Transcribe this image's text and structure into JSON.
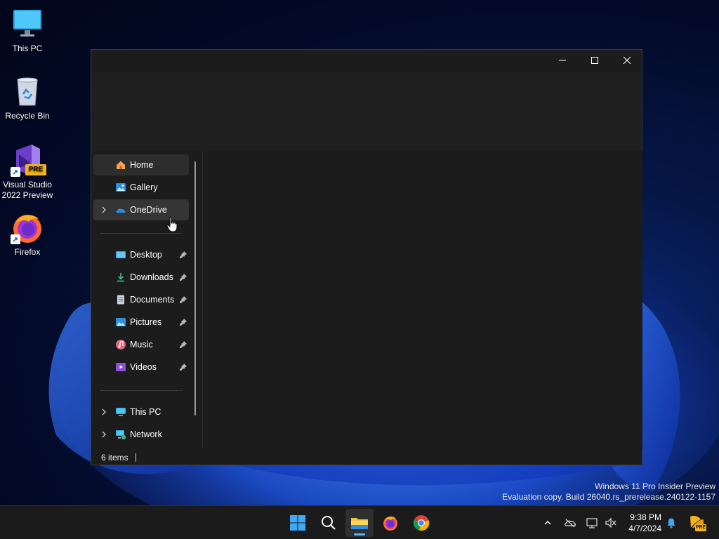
{
  "desktop": {
    "icons": [
      {
        "label": "This PC"
      },
      {
        "label": "Recycle Bin"
      },
      {
        "label": "Visual Studio\n2022 Preview",
        "line1": "Visual Studio",
        "line2": "2022 Preview",
        "badge": "PRE"
      },
      {
        "label": "Firefox"
      }
    ]
  },
  "window": {
    "nav": {
      "items": [
        {
          "label": "Home",
          "icon": "home-icon",
          "state": "selected"
        },
        {
          "label": "Gallery",
          "icon": "gallery-icon"
        },
        {
          "label": "OneDrive",
          "icon": "onedrive-icon",
          "state": "hover",
          "expandable": true
        },
        {
          "label": "Desktop",
          "icon": "desktop-folder-icon",
          "pinned": true
        },
        {
          "label": "Downloads",
          "icon": "downloads-icon",
          "pinned": true
        },
        {
          "label": "Documents",
          "icon": "documents-icon",
          "pinned": true
        },
        {
          "label": "Pictures",
          "icon": "pictures-icon",
          "pinned": true
        },
        {
          "label": "Music",
          "icon": "music-icon",
          "pinned": true
        },
        {
          "label": "Videos",
          "icon": "videos-icon",
          "pinned": true
        },
        {
          "label": "This PC",
          "icon": "this-pc-icon",
          "expandable": true
        },
        {
          "label": "Network",
          "icon": "network-icon",
          "expandable": true
        }
      ]
    },
    "status": {
      "items_count": "6 items"
    }
  },
  "watermark": {
    "line1": "Windows 11 Pro Insider Preview",
    "line2": "Evaluation copy. Build 26040.rs_prerelease.240122-1157"
  },
  "taskbar": {
    "apps": [
      "start-icon",
      "search-icon",
      "file-explorer-icon",
      "firefox-icon",
      "chrome-icon"
    ],
    "clock": {
      "time": "9:38 PM",
      "date": "4/7/2024"
    },
    "tray_badge": "PRE"
  },
  "colors": {
    "accent": "#5ab4ff",
    "window_bg": "#1c1c1c",
    "taskbar_bg": "#1b1b1b"
  }
}
